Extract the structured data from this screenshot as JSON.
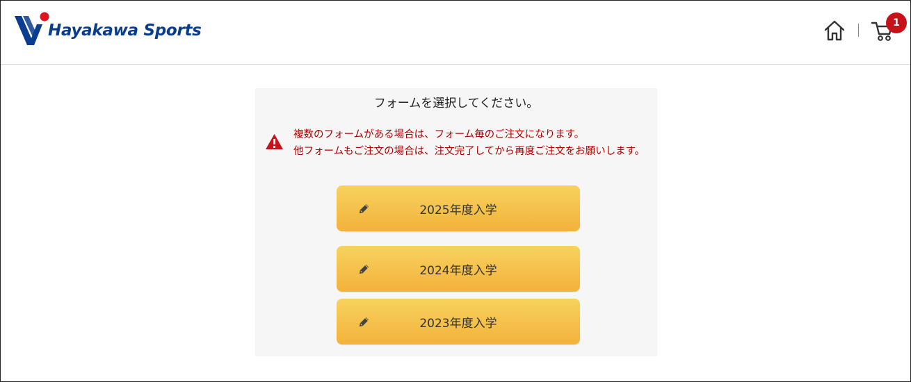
{
  "header": {
    "logo_text": "Hayakawa Sports",
    "home_icon": "home-icon",
    "cart_icon": "cart-icon",
    "cart_count": "1",
    "colors": {
      "logo_blue": "#0a3d8f",
      "badge_red": "#c8121b"
    }
  },
  "panel": {
    "title": "フォームを選択してください。",
    "warning": {
      "icon": "warning-icon",
      "line1": "複数のフォームがある場合は、フォーム毎のご注文になります。",
      "line2": "他フォームもご注文の場合は、注文完了してから再度ご注文をお願いします。",
      "color": "#b00000"
    },
    "forms": [
      {
        "label": "2025年度入学",
        "icon": "pencil-icon"
      },
      {
        "label": "2024年度入学",
        "icon": "pencil-icon"
      },
      {
        "label": "2023年度入学",
        "icon": "pencil-icon"
      }
    ],
    "button_colors": {
      "top": "#f7d25e",
      "bottom": "#f3b23b"
    }
  }
}
